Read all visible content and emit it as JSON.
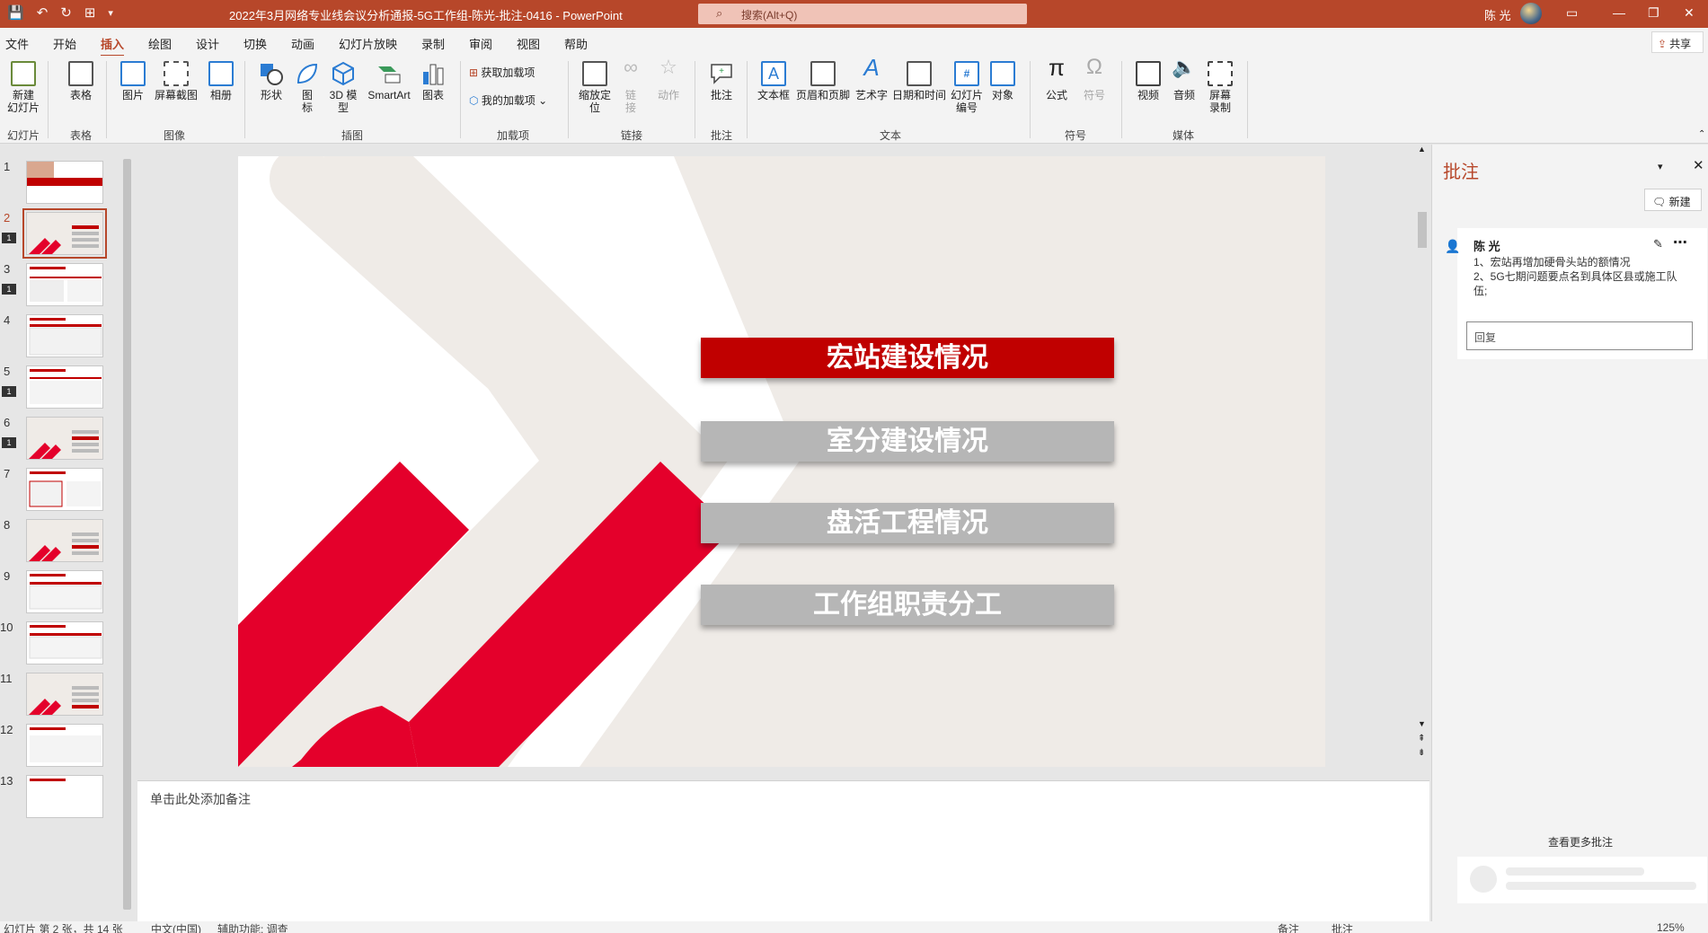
{
  "titlebar": {
    "document_title": "2022年3月网络专业线会议分析通报-5G工作组-陈光-批注-0416  -  PowerPoint",
    "search_placeholder": "搜索(Alt+Q)",
    "user": "陈 光"
  },
  "menu": {
    "items": [
      "文件",
      "开始",
      "插入",
      "绘图",
      "设计",
      "切换",
      "动画",
      "幻灯片放映",
      "录制",
      "审阅",
      "视图",
      "帮助"
    ],
    "active": "插入",
    "share": "共享"
  },
  "ribbon": {
    "new_slide": "新建\n幻灯片",
    "table": "表格",
    "picture": "图片",
    "screenshot": "屏幕截图",
    "album": "相册",
    "shapes": "形状",
    "icons": "图\n标",
    "model3d": "3D 模\n型",
    "smartart": "SmartArt",
    "chart": "图表",
    "get_addins": "获取加载项",
    "my_addins": "我的加载项",
    "zoom": "缩放定\n位",
    "link": "链\n接",
    "action": "动作",
    "comment": "批注",
    "textbox": "文本框",
    "header_footer": "页眉和页脚",
    "wordart": "艺术字",
    "datetime": "日期和时间",
    "slide_number": "幻灯片\n编号",
    "object": "对象",
    "equation": "公式",
    "symbol": "符号",
    "video": "视频",
    "audio": "音频",
    "screen_record": "屏幕\n录制",
    "groups": {
      "slides": "幻灯片",
      "tables": "表格",
      "images": "图像",
      "illustrations": "插图",
      "addins": "加载项",
      "links": "链接",
      "comments": "批注",
      "text": "文本",
      "symbols": "符号",
      "media": "媒体"
    }
  },
  "thumbnails": [
    "1",
    "2",
    "3",
    "4",
    "5",
    "6",
    "7",
    "8",
    "9",
    "10",
    "11",
    "12",
    "13"
  ],
  "slide": {
    "buttons": [
      "宏站建设情况",
      "室分建设情况",
      "盘活工程情况",
      "工作组职责分工"
    ],
    "colors": {
      "red": "#e4002b",
      "highlight": "#c00000",
      "gray": "#b6b6b6"
    }
  },
  "notes": {
    "placeholder": "单击此处添加备注"
  },
  "comments": {
    "title": "批注",
    "new_button": "新建",
    "author": "陈 光",
    "body": [
      "1、宏站再增加硬骨头站的额情况",
      "2、5G七期问题要点名到具体区县或施工队伍;"
    ],
    "reply_placeholder": "回复",
    "view_more": "查看更多批注"
  },
  "status": {
    "slide_of": "幻灯片 第 2 张，共 14 张",
    "language": "中文(中国)",
    "accessibility": "辅助功能: 调查",
    "notes": "备注",
    "comments": "批注",
    "zoom": "125%"
  },
  "accent": "#b7472a"
}
